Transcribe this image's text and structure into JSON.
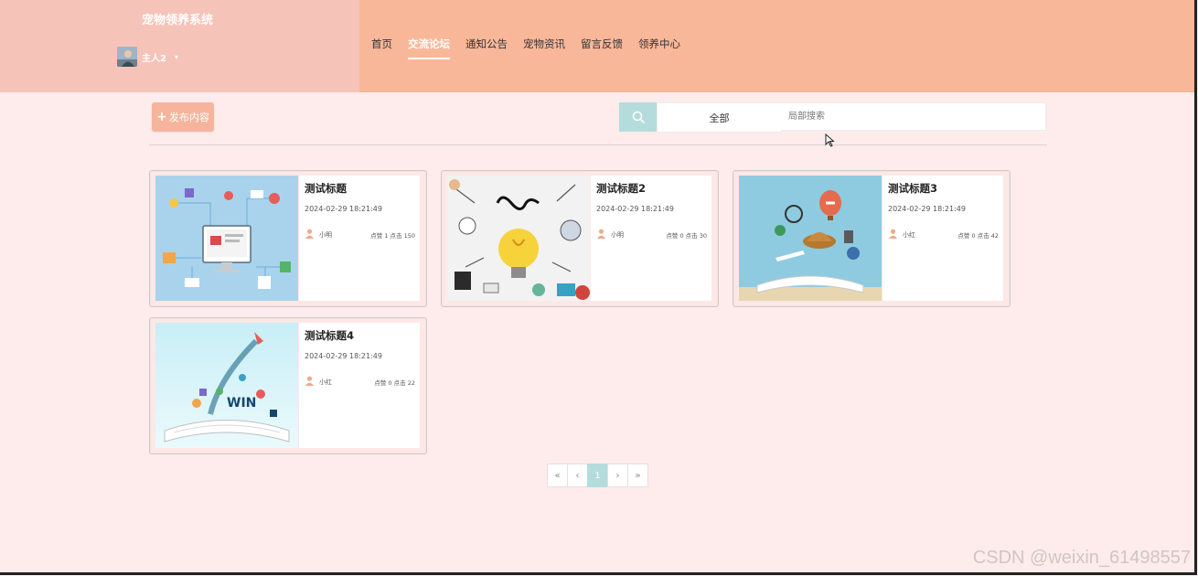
{
  "brand": {
    "title": "宠物领养系统"
  },
  "user": {
    "name": "主人2",
    "caret": "▾"
  },
  "nav": [
    {
      "label": "首页",
      "active": false
    },
    {
      "label": "交流论坛",
      "active": true
    },
    {
      "label": "通知公告",
      "active": false
    },
    {
      "label": "宠物资讯",
      "active": false
    },
    {
      "label": "留言反馈",
      "active": false
    },
    {
      "label": "领养中心",
      "active": false
    }
  ],
  "toolbar": {
    "publish_label": "发布内容",
    "category_label": "全部",
    "search_placeholder": "局部搜索"
  },
  "posts": [
    {
      "title": "测试标题",
      "date": "2024-02-29 18:21:49",
      "author": "小明",
      "stats": "点赞 1 点击 150"
    },
    {
      "title": "测试标题2",
      "date": "2024-02-29 18:21:49",
      "author": "小明",
      "stats": "点赞 0 点击 30"
    },
    {
      "title": "测试标题3",
      "date": "2024-02-29 18:21:49",
      "author": "小红",
      "stats": "点赞 0 点击 42"
    },
    {
      "title": "测试标题4",
      "date": "2024-02-29 18:21:49",
      "author": "小红",
      "stats": "点赞 0 点击 22"
    }
  ],
  "pagination": {
    "first": "«",
    "prev": "‹",
    "current": "1",
    "next": "›",
    "last": "»"
  },
  "watermark": "CSDN @weixin_61498557",
  "colors": {
    "brand_bg": "#f6c3b8",
    "nav_bg": "#f9b79a",
    "page_bg": "#fdeceb",
    "accent": "#b5dcdc",
    "publish": "#f6b49c"
  }
}
